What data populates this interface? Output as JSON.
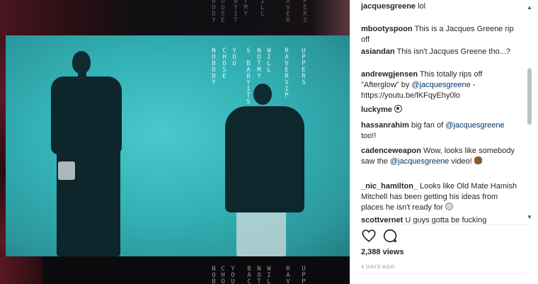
{
  "video": {
    "lyric_columns_top": [
      {
        "text": "BODY"
      },
      {
        "text": "OUSE"
      },
      {
        "text": "BYIT"
      },
      {
        "text": "YMY"
      },
      {
        "text": "ILL"
      },
      {
        "text": "AVER"
      },
      {
        "text": "PERS"
      }
    ],
    "lyric_columns_mid": [
      {
        "text": "NOBODY"
      },
      {
        "text": "CHOSE"
      },
      {
        "text": "YOU"
      },
      {
        "text": "S BABYITS"
      },
      {
        "text": "NOTMY"
      },
      {
        "text": "WILL"
      },
      {
        "text": "RAVERVIP"
      },
      {
        "text": "UPPERS"
      }
    ],
    "lyric_columns_bottom": [
      {
        "text": "NOBO"
      },
      {
        "text": "CHOS"
      },
      {
        "text": "YOU"
      },
      {
        "text": "BACI"
      },
      {
        "text": "NOTM"
      },
      {
        "text": "WILL"
      },
      {
        "text": "RAVI"
      },
      {
        "text": "UPP"
      }
    ]
  },
  "comments": [
    {
      "user": "jacquesgreene",
      "parts": [
        {
          "t": " lol"
        }
      ]
    },
    {
      "user": "mbootyspoon",
      "parts": [
        {
          "t": " This is a Jacques Greene rip off"
        }
      ]
    },
    {
      "user": "asiandan",
      "parts": [
        {
          "t": " This isn't Jacques Greene tho...?"
        }
      ]
    },
    {
      "user": "andrewgjensen",
      "parts": [
        {
          "t": " This totally rips off \"Afterglow\" by "
        },
        {
          "m": "@jacquesgreene"
        },
        {
          "t": " - https://youtu.be/lKFqyEhy0lo"
        }
      ]
    },
    {
      "user": "luckyme",
      "parts": [
        {
          "t": " "
        }
      ],
      "emoji": "eye"
    },
    {
      "user": "hassanrahim",
      "parts": [
        {
          "t": " big fan of "
        },
        {
          "m": "@jacquesgreene"
        },
        {
          "t": " too!!"
        }
      ]
    },
    {
      "user": "cadenceweapon",
      "parts": [
        {
          "t": " Wow, looks like somebody saw the "
        },
        {
          "m": "@jacquesgreene"
        },
        {
          "t": " video! "
        }
      ],
      "emoji": "monkey"
    },
    {
      "user": "_nic_hamilton_",
      "parts": [
        {
          "t": " Looks like Old Mate Hamish Mitchell has been getting his ideas from places he isn't ready for "
        }
      ],
      "emoji": "skull"
    },
    {
      "user": "scottvernet",
      "parts": [
        {
          "t": " U guys gotta be fucking"
        }
      ]
    }
  ],
  "footer": {
    "views": "2,388 views",
    "timestamp": "4 DAYS AGO"
  },
  "icons": {
    "like": "heart-icon",
    "comment": "comment-icon",
    "scroll_up": "chevron-up-icon",
    "scroll_down": "chevron-down-icon"
  }
}
